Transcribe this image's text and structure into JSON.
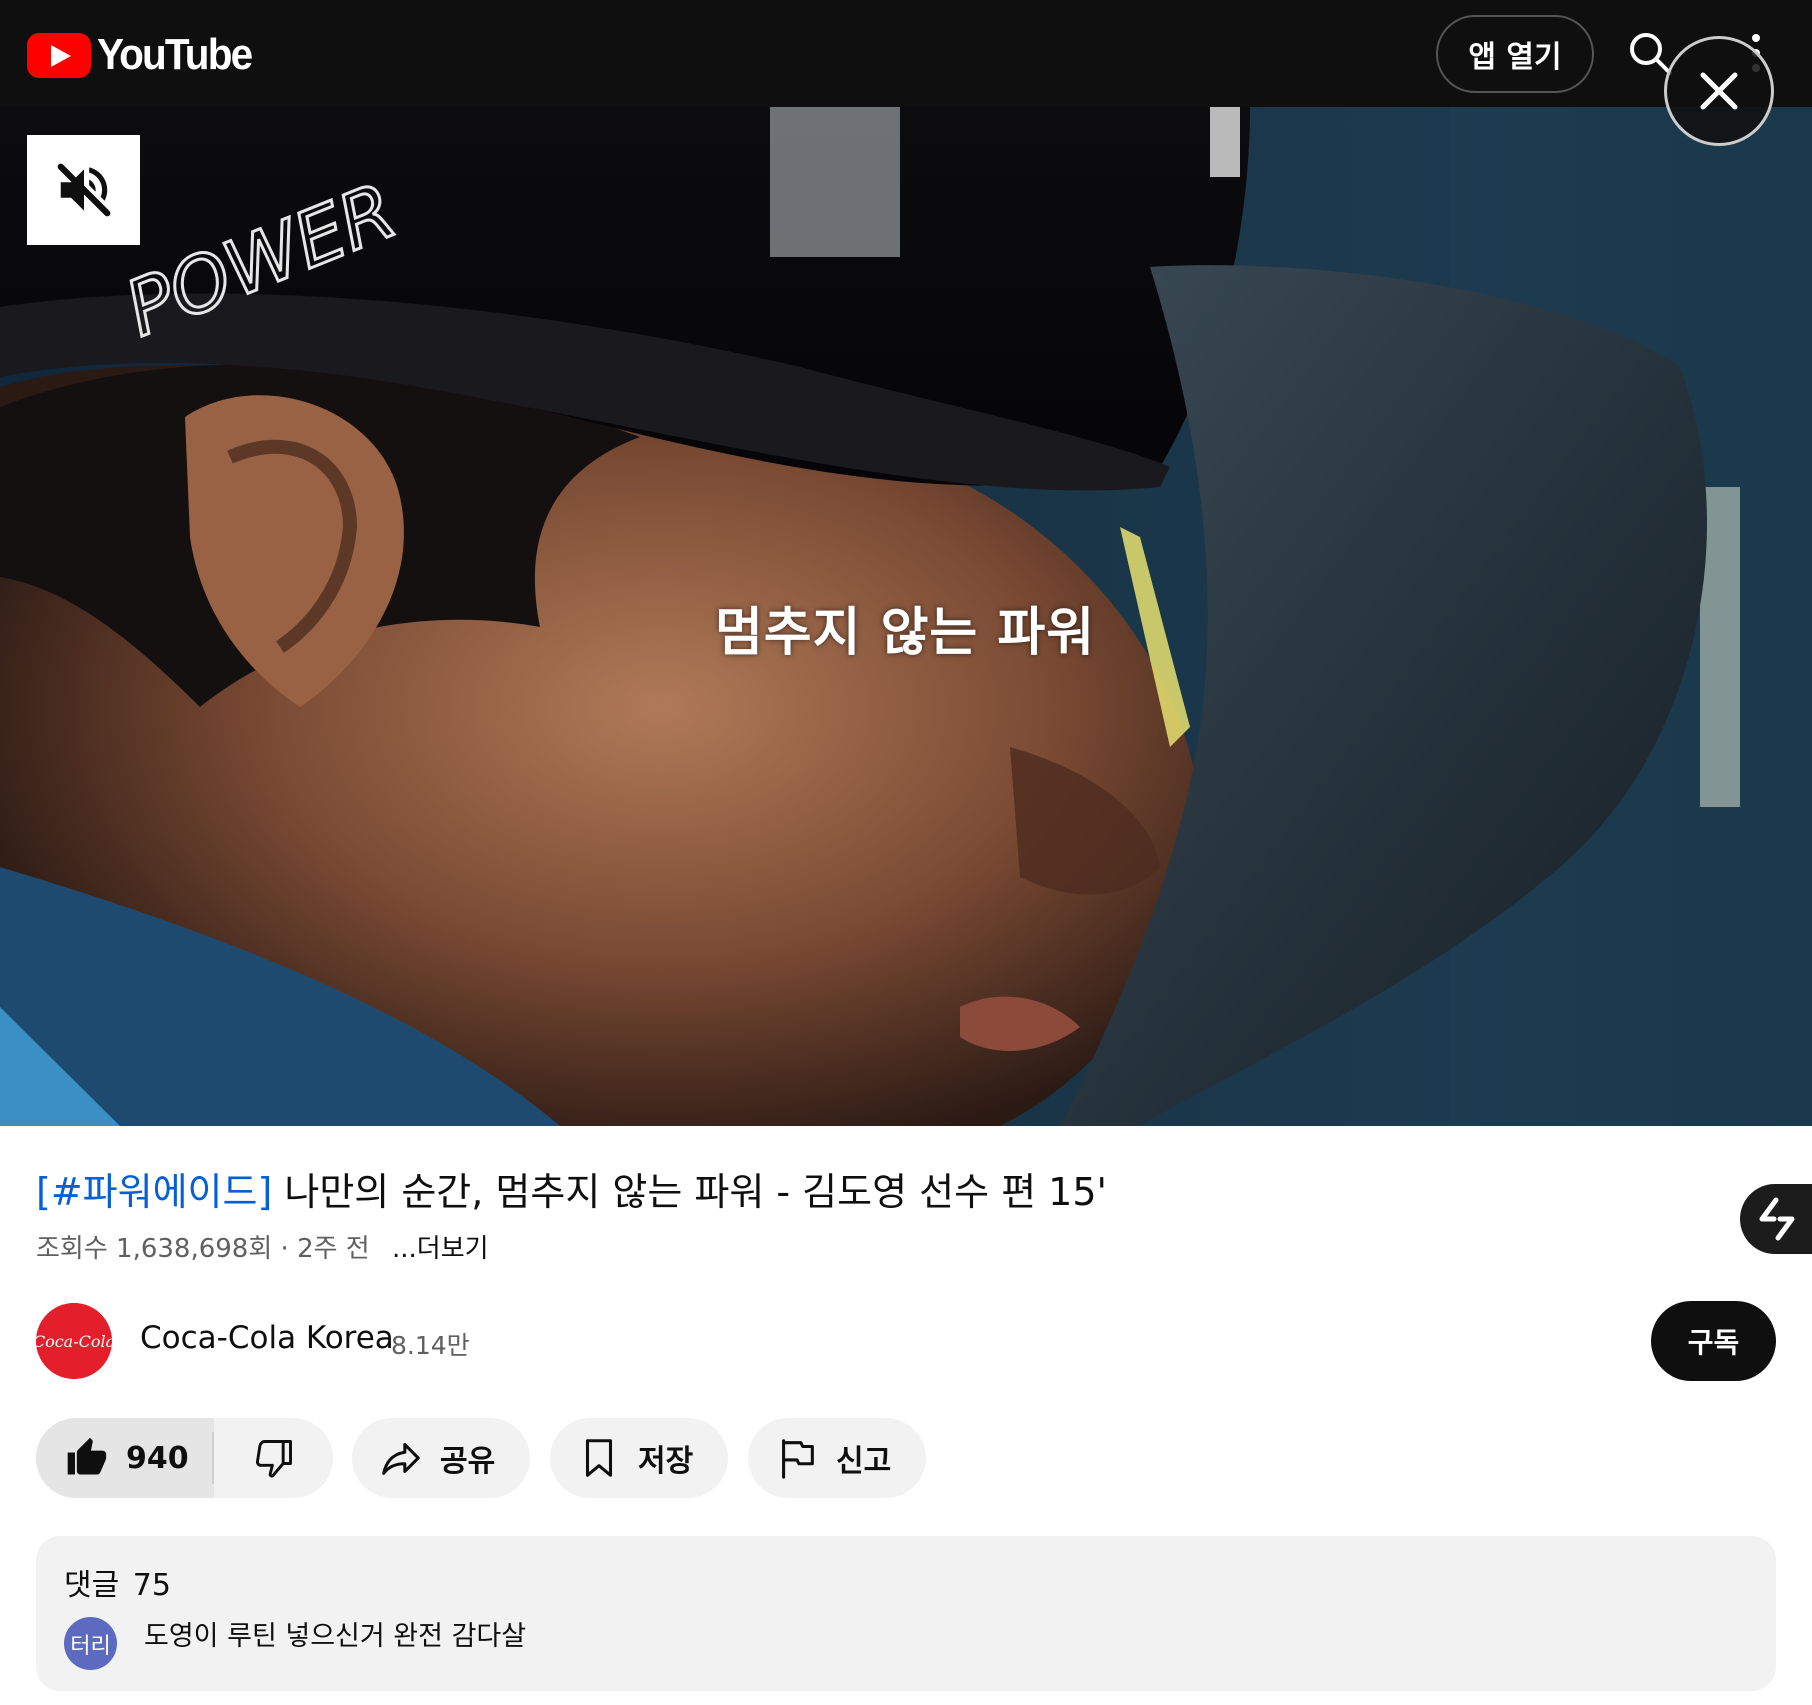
{
  "header": {
    "logo_text": "YouTube",
    "open_app_label": "앱 열기",
    "search_icon": "search-icon",
    "more_icon": "more-vert-icon"
  },
  "video": {
    "caption": "멈추지 않는 파워",
    "cap_text": "POWER",
    "mute_icon": "volume-off-icon",
    "close_icon": "close-icon"
  },
  "info": {
    "title_hashtag": "[#파워에이드]",
    "title_rest": " 나만의 순간, 멈추지 않는 파워 - 김도영 선수 편 15'",
    "views": "조회수 1,638,698회",
    "separator": "·",
    "time_ago": "2주 전",
    "more_label": "...더보기"
  },
  "channel": {
    "name": "Coca-Cola Korea",
    "subscribers": "8.14만",
    "subscribe_label": "구독",
    "avatar_text": "Coca-Cola"
  },
  "actions": {
    "like_count": "940",
    "share_label": "공유",
    "save_label": "저장",
    "report_label": "신고"
  },
  "comments": {
    "label": "댓글",
    "count": "75",
    "top_comment": {
      "author_initials": "터리",
      "text": "도영이 루틴 넣으신거 완전 감다살"
    }
  },
  "colors": {
    "brand_red": "#ff0000",
    "hashtag_blue": "#065fd4",
    "topbar_bg": "#0f0f0f",
    "commenter_avatar": "#5c6bc0"
  }
}
